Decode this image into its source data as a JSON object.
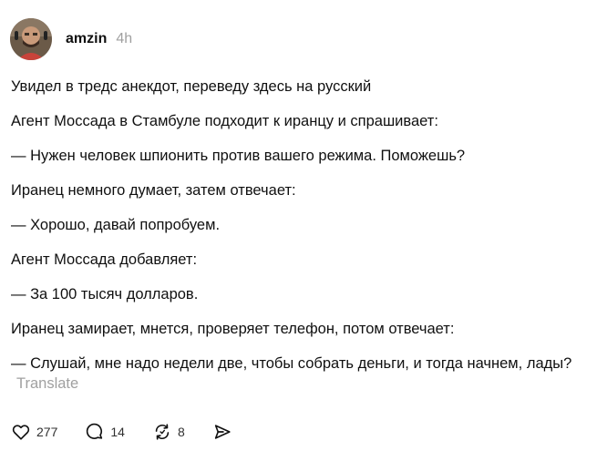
{
  "post": {
    "author": "amzin",
    "time": "4h",
    "paragraphs": [
      "Увидел в тредс анекдот, переведу здесь на русский",
      "Агент Моссада в Стамбуле подходит к иранцу и спрашивает:",
      "— Нужен человек шпионить против вашего режима. Поможешь?",
      "Иранец немного думает, затем отвечает:",
      "— Хорошо, давай попробуем.",
      "Агент Моссада добавляет:",
      "— За 100 тысяч долларов.",
      "Иранец замирает, мнется, проверяет телефон, потом отвечает:",
      "— Слушай, мне надо недели две, чтобы собрать деньги, и тогда начнем, лады?"
    ],
    "translate_label": "Translate"
  },
  "actions": {
    "likes": "277",
    "replies": "14",
    "reposts": "8",
    "icons": {
      "like": "heart-icon",
      "reply": "comment-icon",
      "repost": "repost-icon",
      "share": "send-icon"
    }
  }
}
